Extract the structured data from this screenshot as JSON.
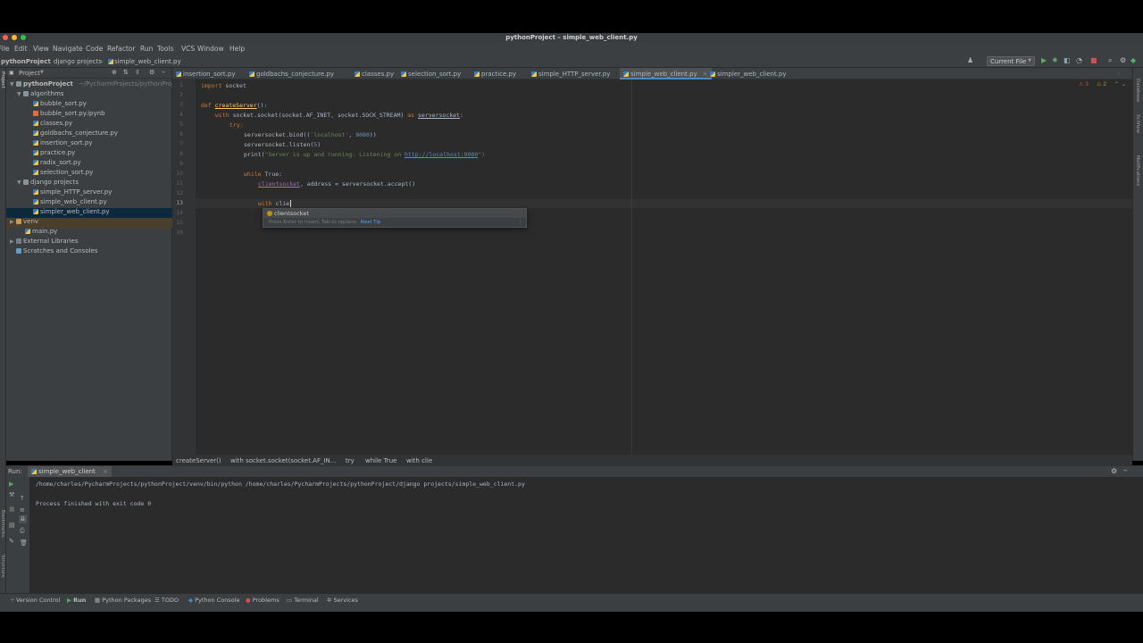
{
  "window": {
    "title": "pythonProject – simple_web_client.py"
  },
  "menu": [
    "File",
    "Edit",
    "View",
    "Navigate",
    "Code",
    "Refactor",
    "Run",
    "Tools",
    "VCS",
    "Window",
    "Help"
  ],
  "breadcrumb": {
    "project": "pythonProject",
    "folder": "django projects",
    "file": "simple_web_client.py"
  },
  "toolbar": {
    "run_config": "Current File"
  },
  "project_panel": {
    "title": "Project",
    "root": "pythonProject",
    "root_path": "~/PycharmProjects/pythonProject",
    "folders": [
      {
        "name": "algorithms",
        "files": [
          "bubble_sort.py",
          "bubble_sort.py.ipynb",
          "classes.py",
          "goldbachs_conjecture.py",
          "insertion_sort.py",
          "practice.py",
          "radix_sort.py",
          "selection_sort.py"
        ]
      },
      {
        "name": "django projects",
        "files": [
          "simple_HTTP_server.py",
          "simple_web_client.py",
          "simpler_web_client.py"
        ]
      }
    ],
    "venv": "venv",
    "main": "main.py",
    "external": "External Libraries",
    "scratches": "Scratches and Consoles"
  },
  "editor_tabs": [
    "insertion_sort.py",
    "goldbachs_conjecture.py",
    "classes.py",
    "selection_sort.py",
    "practice.py",
    "simple_HTTP_server.py",
    "simple_web_client.py",
    "simpler_web_client.py"
  ],
  "active_tab": "simple_web_client.py",
  "inspections": {
    "warnings": "3",
    "weak": "2"
  },
  "code": {
    "line_numbers": [
      "1",
      "2",
      "3",
      "4",
      "5",
      "6",
      "7",
      "8",
      "9",
      "10",
      "11",
      "12",
      "13",
      "14",
      "15",
      "16"
    ],
    "l1_kw": "import",
    "l1_rest": " socket",
    "l3_kw": "def",
    "l3_fn": "createServer",
    "l3_rest": "():",
    "l4_kw": "with",
    "l4_rest": " socket.socket(socket.AF_INET, socket.SOCK_STREAM) ",
    "l4_as": "as",
    "l4_var": "serversocket",
    "l4_end": ":",
    "l5_kw": "try:",
    "l6_pre": "serversocket.bind((",
    "l6_str": "'localhost'",
    "l6_mid": ", ",
    "l6_num": "9080",
    "l6_end": "))",
    "l7_pre": "serversocket.listen(",
    "l7_num": "5",
    "l7_end": ")",
    "l8_pre": "print(",
    "l8_str": "\"Server is up and running. Listening on ",
    "l8_url": "http://localhost:9080",
    "l8_end": "\")",
    "l10_kw": "while",
    "l10_rest": " True:",
    "l11_var": "clientsocket",
    "l11_rest": ", address = serversocket.accept()",
    "l13_kw": "with",
    "l13_rest": " clie"
  },
  "completion": {
    "item": "clientsocket",
    "hint_pre": "Press Enter to insert, Tab to replace",
    "hint_link": "Next Tip"
  },
  "editor_breadcrumbs": [
    "createServer()",
    "with socket.socket(socket.AF_IN...",
    "try",
    "while True",
    "with clie"
  ],
  "run": {
    "label": "Run:",
    "tab": "simple_web_client",
    "cmd": "/home/charles/PycharmProjects/pythonProject/venv/bin/python /home/charles/PycharmProjects/pythonProject/django projects/simple_web_client.py",
    "exit": "Process finished with exit code 0"
  },
  "bottom_tools": [
    "Version Control",
    "Run",
    "Python Packages",
    "TODO",
    "Python Console",
    "Problems",
    "Terminal",
    "Services"
  ],
  "side_tools": {
    "left": "Project",
    "right1": "Database",
    "right2": "SciView",
    "right3": "Notifications",
    "left_bottom1": "Bookmarks",
    "left_bottom2": "Structure"
  },
  "colors": {
    "bg": "#2b2b2b",
    "panel": "#3c3f41",
    "selection": "#0d293e",
    "accent": "#4a88c7"
  }
}
